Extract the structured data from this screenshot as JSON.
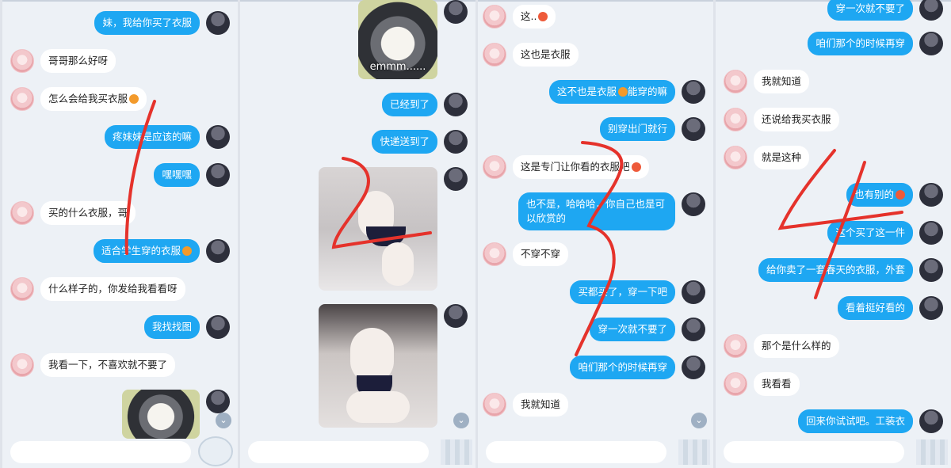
{
  "panels": [
    {
      "messages": [
        {
          "side": "right",
          "text": "妹，我给你买了衣服"
        },
        {
          "side": "left",
          "text": "哥哥那么好呀"
        },
        {
          "side": "left",
          "text": "怎么会给我买衣服",
          "emoji": "orange"
        },
        {
          "side": "right",
          "text": "疼妹妹是应该的嘛"
        },
        {
          "side": "right",
          "text": "嘿嘿嘿"
        },
        {
          "side": "left",
          "text": "买的什么衣服，哥"
        },
        {
          "side": "right",
          "text": "适合学生穿的衣服",
          "emoji": "orange"
        },
        {
          "side": "left",
          "text": "什么样子的，你发给我看看呀"
        },
        {
          "side": "right",
          "text": "我找找图"
        },
        {
          "side": "left",
          "text": "我看一下，不喜欢就不要了"
        }
      ],
      "annotation": "1"
    },
    {
      "image_caption": "emmm......",
      "messages": [
        {
          "side": "right",
          "text": "已经到了"
        },
        {
          "side": "right",
          "text": "快递送到了"
        }
      ],
      "annotation": "2"
    },
    {
      "messages": [
        {
          "side": "left",
          "text": "这..",
          "emoji": "red"
        },
        {
          "side": "left",
          "text": "这也是衣服"
        },
        {
          "side": "right",
          "text": "这不也是衣服",
          "emoji": "orange",
          "text_after": "能穿的嘛"
        },
        {
          "side": "right",
          "text": "别穿出门就行"
        },
        {
          "side": "left",
          "text": "这是专门让你看的衣服吧",
          "emoji": "red"
        },
        {
          "side": "right",
          "text": "也不是，哈哈哈，你自己也是可以欣赏的"
        },
        {
          "side": "left",
          "text": "不穿不穿"
        },
        {
          "side": "right",
          "text": "买都买了，穿一下吧"
        },
        {
          "side": "right",
          "text": "穿一次就不要了"
        },
        {
          "side": "right",
          "text": "咱们那个的时候再穿"
        },
        {
          "side": "left",
          "text": "我就知道"
        }
      ],
      "annotation": "3"
    },
    {
      "messages": [
        {
          "side": "right",
          "text": "穿一次就不要了"
        },
        {
          "side": "right",
          "text": "咱们那个的时候再穿"
        },
        {
          "side": "left",
          "text": "我就知道"
        },
        {
          "side": "left",
          "text": "还说给我买衣服"
        },
        {
          "side": "left",
          "text": "就是这种"
        },
        {
          "side": "right",
          "text": "也有别的",
          "emoji": "red"
        },
        {
          "side": "right",
          "text": "这个买了这一件"
        },
        {
          "side": "right",
          "text": "给你卖了一套春天的衣服，外套"
        },
        {
          "side": "right",
          "text": "看着挺好看的"
        },
        {
          "side": "left",
          "text": "那个是什么样的"
        },
        {
          "side": "left",
          "text": "我看看"
        },
        {
          "side": "right",
          "text": "回来你试试吧。工装衣"
        }
      ],
      "annotation": "4"
    }
  ],
  "colors": {
    "my_bubble": "#1ea7f2",
    "their_bubble": "#ffffff",
    "annotation": "#e5322b"
  }
}
